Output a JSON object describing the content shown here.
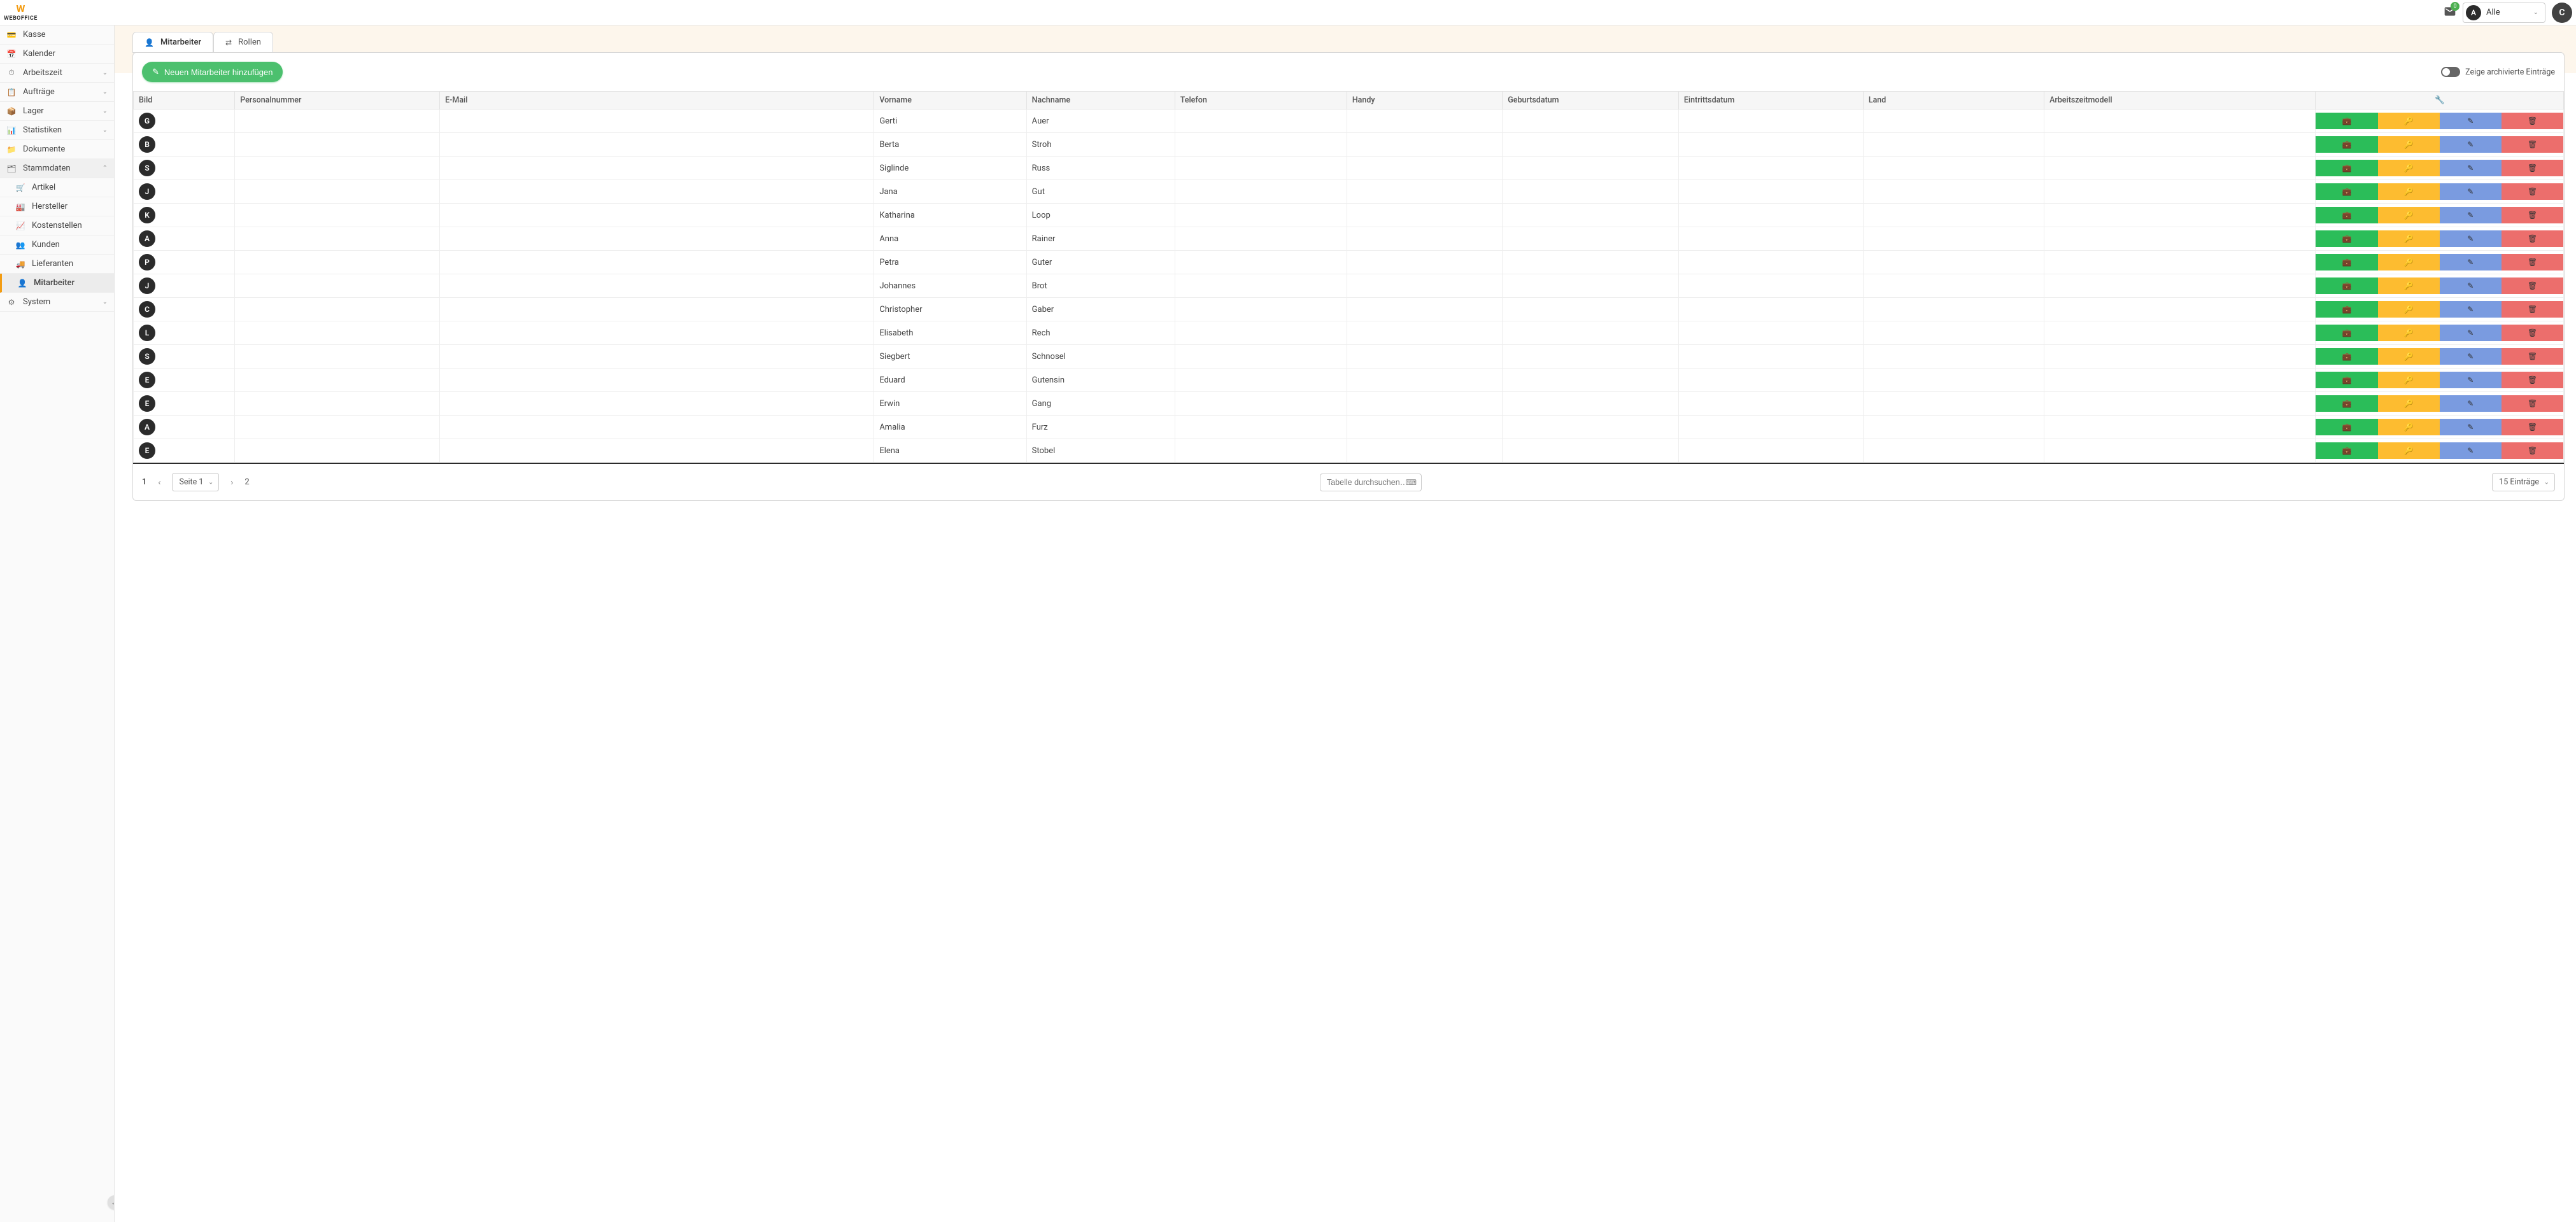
{
  "header": {
    "brand": "WEBOFFICE",
    "mail_count": "0",
    "location_initial": "A",
    "location_label": "Alle",
    "user_initial": "C"
  },
  "sidebar": {
    "items": [
      {
        "icon": "💳",
        "label": "Kasse",
        "expandable": false
      },
      {
        "icon": "📅",
        "label": "Kalender",
        "expandable": false
      },
      {
        "icon": "⏱",
        "label": "Arbeitszeit",
        "expandable": true
      },
      {
        "icon": "📋",
        "label": "Aufträge",
        "expandable": true
      },
      {
        "icon": "📦",
        "label": "Lager",
        "expandable": true
      },
      {
        "icon": "📊",
        "label": "Statistiken",
        "expandable": true
      },
      {
        "icon": "📁",
        "label": "Dokumente",
        "expandable": false
      },
      {
        "icon": "🗂",
        "label": "Stammdaten",
        "expandable": true,
        "expanded": true,
        "children": [
          {
            "icon": "🛒",
            "label": "Artikel"
          },
          {
            "icon": "🏭",
            "label": "Hersteller"
          },
          {
            "icon": "📈",
            "label": "Kostenstellen"
          },
          {
            "icon": "👥",
            "label": "Kunden"
          },
          {
            "icon": "🚚",
            "label": "Lieferanten"
          },
          {
            "icon": "👤",
            "label": "Mitarbeiter",
            "active": true
          }
        ]
      },
      {
        "icon": "⚙",
        "label": "System",
        "expandable": true
      }
    ]
  },
  "tabs": {
    "employee": "Mitarbeiter",
    "roles": "Rollen"
  },
  "panel": {
    "add_button": "Neuen Mitarbeiter hinzufügen",
    "archive_toggle": "Zeige archivierte Einträge"
  },
  "table": {
    "columns": [
      "Bild",
      "Personalnummer",
      "E-Mail",
      "Vorname",
      "Nachname",
      "Telefon",
      "Handy",
      "Geburtsdatum",
      "Eintrittsdatum",
      "Land",
      "Arbeitszeitmodell"
    ],
    "rows": [
      {
        "initial": "G",
        "vorname": "Gerti",
        "nachname": "Auer"
      },
      {
        "initial": "B",
        "vorname": "Berta",
        "nachname": "Stroh"
      },
      {
        "initial": "S",
        "vorname": "Siglinde",
        "nachname": "Russ"
      },
      {
        "initial": "J",
        "vorname": "Jana",
        "nachname": "Gut"
      },
      {
        "initial": "K",
        "vorname": "Katharina",
        "nachname": "Loop"
      },
      {
        "initial": "A",
        "vorname": "Anna",
        "nachname": "Rainer"
      },
      {
        "initial": "P",
        "vorname": "Petra",
        "nachname": "Guter"
      },
      {
        "initial": "J",
        "vorname": "Johannes",
        "nachname": "Brot"
      },
      {
        "initial": "C",
        "vorname": "Christopher",
        "nachname": "Gaber"
      },
      {
        "initial": "L",
        "vorname": "Elisabeth",
        "nachname": "Rech"
      },
      {
        "initial": "S",
        "vorname": "Siegbert",
        "nachname": "Schnosel"
      },
      {
        "initial": "E",
        "vorname": "Eduard",
        "nachname": "Gutensin"
      },
      {
        "initial": "E",
        "vorname": "Erwin",
        "nachname": "Gang"
      },
      {
        "initial": "A",
        "vorname": "Amalia",
        "nachname": "Furz"
      },
      {
        "initial": "E",
        "vorname": "Elena",
        "nachname": "Stobel"
      }
    ]
  },
  "pager": {
    "page1": "1",
    "page2": "2",
    "page_select": "Seite 1",
    "search_placeholder": "Tabelle durchsuchen…",
    "entries_select": "15 Einträge"
  }
}
